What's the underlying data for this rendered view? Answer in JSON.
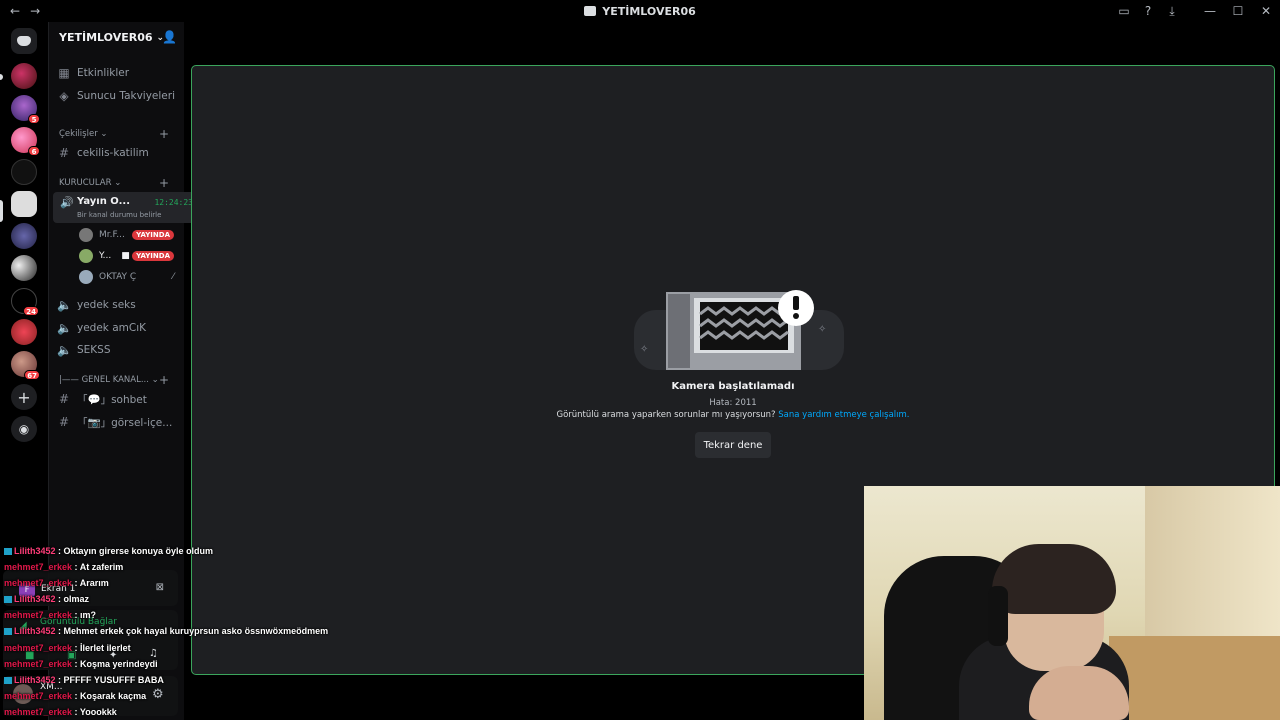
{
  "titlebar": {
    "title": "YETİMLOVER06",
    "back_icon": "←",
    "forward_icon": "→",
    "inbox_icon": "▭",
    "help_icon": "?",
    "download_icon": "⤓",
    "minimize_icon": "—",
    "maximize_icon": "☐",
    "close_icon": "✕"
  },
  "guilds": {
    "badges": [
      "5",
      "6",
      "24",
      "67"
    ],
    "add_icon": "+",
    "discover_icon": "◉"
  },
  "server": {
    "name": "YETİMLOVER06",
    "chevron": "⌄",
    "invite_icon": "👤"
  },
  "channels": {
    "events": "Etkinlikler",
    "boosts": "Sunucu Takviyeleri",
    "cat_cekilisler": "Çekilişler",
    "cekilis_katilim": "cekilis-katilim",
    "cat_kurucular": "KURUCULAR",
    "voice_active_name": "Yayın O...",
    "voice_active_time": "12:24:23",
    "voice_active_status": "Bir kanal durumu belirle",
    "voice_users": [
      {
        "name": "Mr.F...",
        "badge": "YAYINDA"
      },
      {
        "name": "Y...",
        "badge": "YAYINDA"
      },
      {
        "name": "OKTAY Ç",
        "badge": ""
      }
    ],
    "yedek_seks": "yedek seks",
    "yedek_amcik": "yedek amCıK",
    "sekss": "SEKSS",
    "cat_genel": "|—— GENEL KANAL...",
    "sohbet": "「💬」sohbet",
    "gorsel": "「📷」görsel-içe..."
  },
  "stage": {
    "error_title": "Kamera başlatılamadı",
    "error_code": "Hata: 2011",
    "help_text": "Görüntülü arama yaparken sorunlar mı yaşıyorsun?",
    "help_link": "Sana yardım etmeye çalışalım.",
    "retry_button": "Tekrar dene"
  },
  "overlay": {
    "screen_label": "Ekran 1",
    "video_label": "Görüntülü Bağlar",
    "user_label": "XM..."
  },
  "chat": [
    {
      "user": "Lilith3452",
      "text": ": Oktayın girerse konuya öyle oldum",
      "tag": true
    },
    {
      "user": "mehmet7_erkek",
      "text": ": At zaferim",
      "tag": false
    },
    {
      "user": "mehmet7_erkek",
      "text": ": Ararım",
      "tag": false
    },
    {
      "user": "Lilith3452",
      "text": ": olmaz",
      "tag": true
    },
    {
      "user": "mehmet7_erkek",
      "text": ": ım?",
      "tag": false
    },
    {
      "user": "Lilith3452",
      "text": ": Mehmet erkek çok hayal kuruyprsun asko össnwöxmeödmem",
      "tag": true
    },
    {
      "user": "mehmet7_erkek",
      "text": ": İlerlet ilerlet",
      "tag": false
    },
    {
      "user": "mehmet7_erkek",
      "text": ": Koşma yerindeydi",
      "tag": false
    },
    {
      "user": "Lilith3452",
      "text": ": PFFFF YUSUFFF BABA",
      "tag": true
    },
    {
      "user": "mehmet7_erkek",
      "text": ": Koşarak kaçma",
      "tag": false
    },
    {
      "user": "mehmet7_erkek",
      "text": ": Yoookkk",
      "tag": false
    }
  ],
  "colors": {
    "accent_green": "#3ba55c",
    "live_red": "#da373c",
    "link_blue": "#00a8fc"
  }
}
